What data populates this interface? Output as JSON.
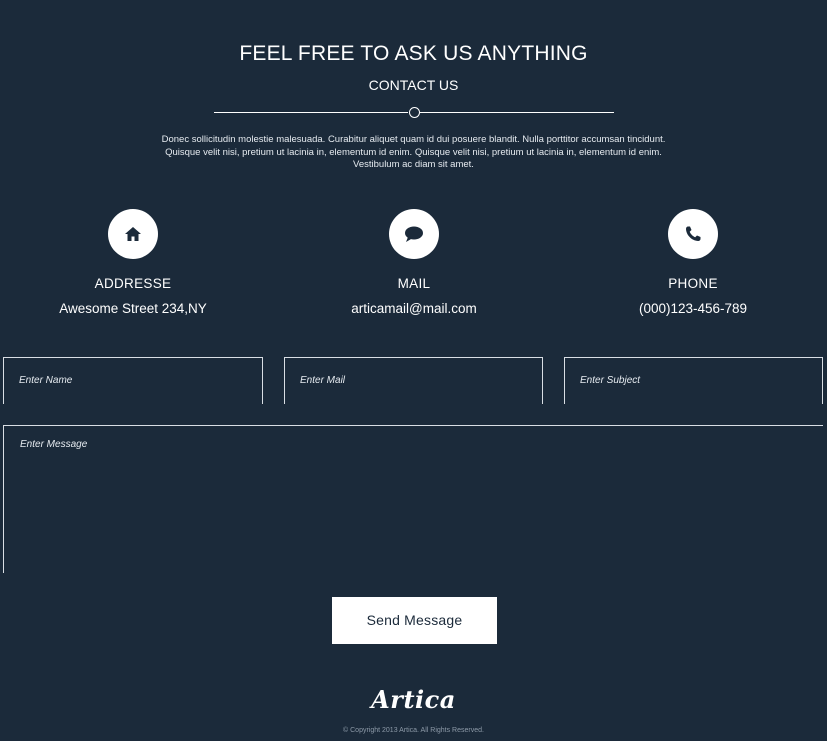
{
  "header": {
    "title": "FEEL FREE TO ASK US ANYTHING",
    "subtitle": "CONTACT US",
    "intro": "Donec sollicitudin molestie malesuada. Curabitur aliquet quam id dui posuere blandit. Nulla porttitor accumsan tincidunt. Quisque velit nisi, pretium ut lacinia in, elementum id enim. Quisque velit nisi, pretium ut lacinia in, elementum id enim. Vestibulum ac diam sit amet."
  },
  "contact": {
    "address": {
      "icon": "home-icon",
      "title": "ADDRESSE",
      "value": "Awesome Street 234,NY"
    },
    "mail": {
      "icon": "chat-bubble-icon",
      "title": "MAIL",
      "value": "articamail@mail.com"
    },
    "phone": {
      "icon": "phone-icon",
      "title": "PHONE",
      "value": "(000)123-456-789"
    }
  },
  "form": {
    "name_placeholder": "Enter Name",
    "mail_placeholder": "Enter Mail",
    "subject_placeholder": "Enter Subject",
    "message_placeholder": "Enter Message",
    "send_label": "Send Message"
  },
  "footer": {
    "logo": "Artica",
    "copyright": "© Copyright 2013 Artica. All Rights Reserved."
  },
  "colors": {
    "background": "#1b2a3a",
    "text": "#ffffff",
    "button_text": "#1b2a3a"
  }
}
